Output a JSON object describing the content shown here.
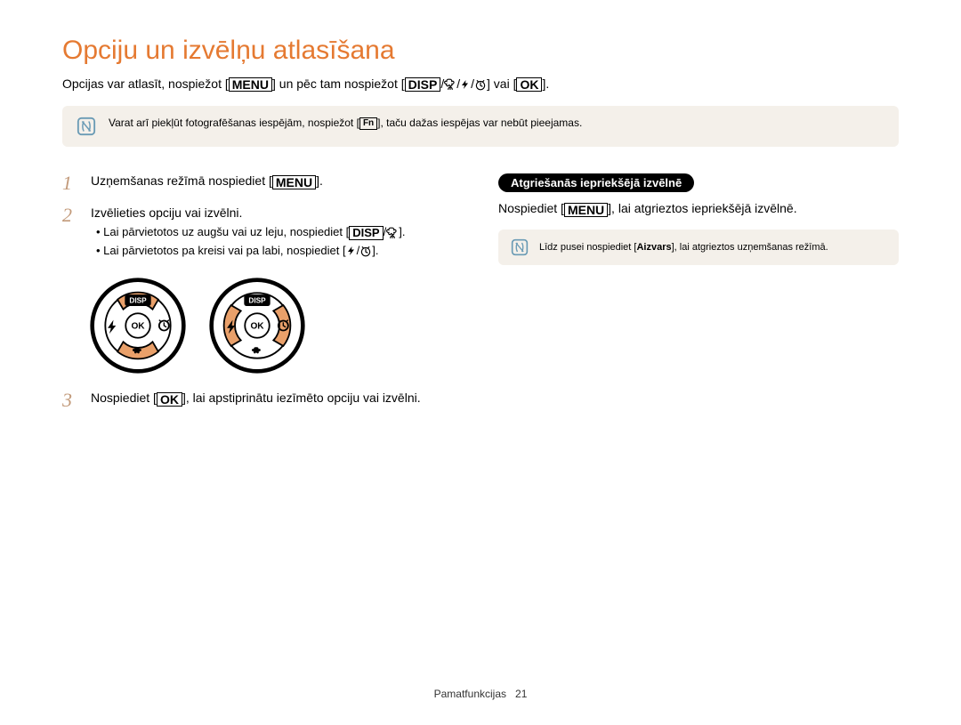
{
  "title": "Opciju un izvēlņu atlasīšana",
  "intro": {
    "p1a": "Opcijas var atlasīt, nospiežot [",
    "menu": "MENU",
    "p1b": "] un pēc tam nospiežot [",
    "disp": "DISP",
    "p1c": "] vai [",
    "ok": "OK",
    "p1d": "]."
  },
  "note1": {
    "t1": "Varat arī piekļūt fotografēšanas iespējām, nospiežot [",
    "fn": "Fn",
    "t2": "], taču dažas iespējas var nebūt pieejamas."
  },
  "steps": {
    "s1": {
      "num": "1",
      "text_a": "Uzņemšanas režīmā nospiediet [",
      "menu": "MENU",
      "text_b": "]."
    },
    "s2": {
      "num": "2",
      "main": "Izvēlieties opciju vai izvēlni.",
      "b1a": "Lai pārvietotos uz augšu vai uz leju, nospiediet [",
      "b1_disp": "DISP",
      "b1b": "].",
      "b2a": "Lai pārvietotos pa kreisi vai pa labi, nospiediet [",
      "b2b": "]."
    },
    "s3": {
      "num": "3",
      "text_a": "Nospiediet [",
      "ok": "OK",
      "text_b": "], lai apstiprinātu iezīmēto opciju vai izvēlni."
    }
  },
  "right": {
    "subhead": "Atgriešanās iepriekšējā izvēlnē",
    "line_a": "Nospiediet [",
    "menu": "MENU",
    "line_b": "], lai atgrieztos iepriekšējā izvēlnē.",
    "note_a": "Līdz pusei nospiediet [",
    "note_bold": "Aizvars",
    "note_b": "], lai atgrieztos uzņemšanas režīmā."
  },
  "dial": {
    "disp": "DISP",
    "ok": "OK"
  },
  "footer": {
    "section": "Pamatfunkcijas",
    "page": "21"
  }
}
